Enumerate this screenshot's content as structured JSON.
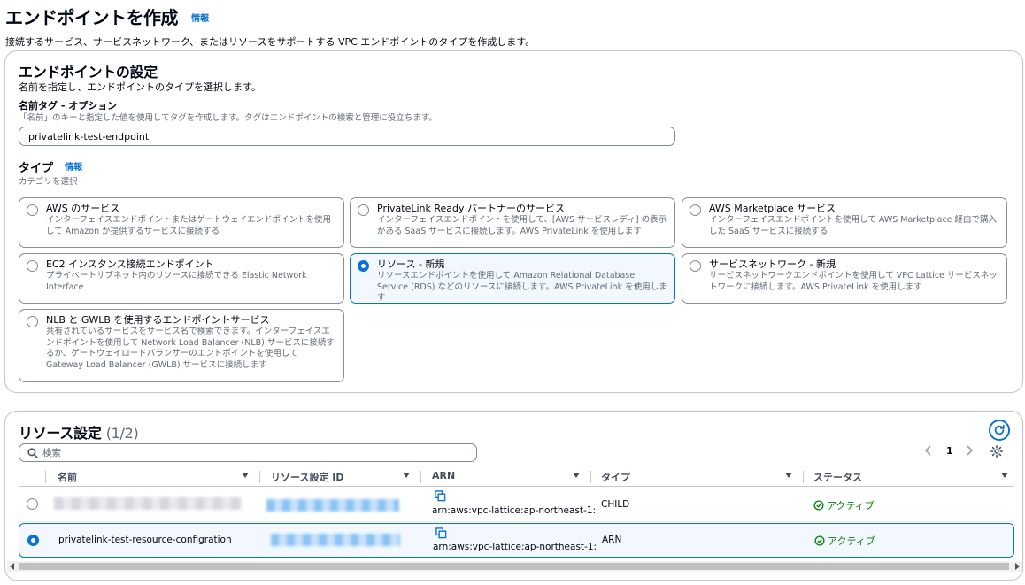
{
  "header": {
    "title": "エンドポイントを作成",
    "info": "情報",
    "description": "接続するサービス、サービスネットワーク、またはリソースをサポートする VPC エンドポイントのタイプを作成します。"
  },
  "settings": {
    "title": "エンドポイントの設定",
    "description": "名前を指定し、エンドポイントのタイプを選択します。",
    "name_tag": {
      "label": "名前タグ - オプション",
      "description": "「名前」のキーと指定した値を使用してタグを作成します。タグはエンドポイントの検索と管理に役立ちます。",
      "value": "privatelink-test-endpoint"
    },
    "type": {
      "label": "タイプ",
      "info": "情報",
      "description": "カテゴリを選択",
      "options": [
        {
          "title": "AWS のサービス",
          "desc": "インターフェイスエンドポイントまたはゲートウェイエンドポイントを使用して Amazon が提供するサービスに接続する",
          "selected": false
        },
        {
          "title": "PrivateLink Ready パートナーのサービス",
          "desc": "インターフェイスエンドポイントを使用して、[AWS サービスレディ] の表示がある SaaS サービスに接続します。AWS PrivateLink を使用します",
          "selected": false
        },
        {
          "title": "AWS Marketplace サービス",
          "desc": "インターフェイスエンドポイントを使用して AWS Marketplace 経由で購入した SaaS サービスに接続する",
          "selected": false
        },
        {
          "title": "EC2 インスタンス接続エンドポイント",
          "desc": "プライベートサブネット内のリソースに接続できる Elastic Network Interface",
          "selected": false
        },
        {
          "title": "リソース - 新規",
          "desc": "リソースエンドポイントを使用して Amazon Relational Database Service (RDS) などのリソースに接続します。AWS PrivateLink を使用します",
          "selected": true
        },
        {
          "title": "サービスネットワーク - 新規",
          "desc": "サービスネットワークエンドポイントを使用して VPC Lattice サービスネットワークに接続します。AWS PrivateLink を使用します",
          "selected": false
        },
        {
          "title": "NLB と GWLB を使用するエンドポイントサービス",
          "desc": "共有されているサービスをサービス名で検索できます。インターフェイスエンドポイントを使用して Network Load Balancer (NLB) サービスに接続するか、ゲートウェイロードバランサーのエンドポイントを使用して Gateway Load Balancer (GWLB) サービスに接続します",
          "selected": false
        }
      ]
    }
  },
  "resources": {
    "title": "リソース設定",
    "count": "(1/2)",
    "search_placeholder": "検索",
    "page": "1",
    "columns": [
      "名前",
      "リソース設定 ID",
      "ARN",
      "タイプ",
      "ステータス"
    ],
    "rows": [
      {
        "name": "",
        "id": "",
        "arn": "arn:aws:vpc-lattice:ap-northeast-1:",
        "type": "CHILD",
        "status": "アクティブ",
        "selected": false
      },
      {
        "name": "privatelink-test-resource-configration",
        "id": "",
        "arn": "arn:aws:vpc-lattice:ap-northeast-1:",
        "type": "ARN",
        "status": "アクティブ",
        "selected": true
      }
    ]
  },
  "colors": {
    "accent": "#0972d3",
    "success": "#037f0c",
    "selected_bg": "#f2f8fd"
  },
  "icons": {
    "refresh": "refresh-icon",
    "search": "search-icon",
    "settings": "gear-icon",
    "copy": "copy-icon",
    "status": "check-circle-icon"
  }
}
